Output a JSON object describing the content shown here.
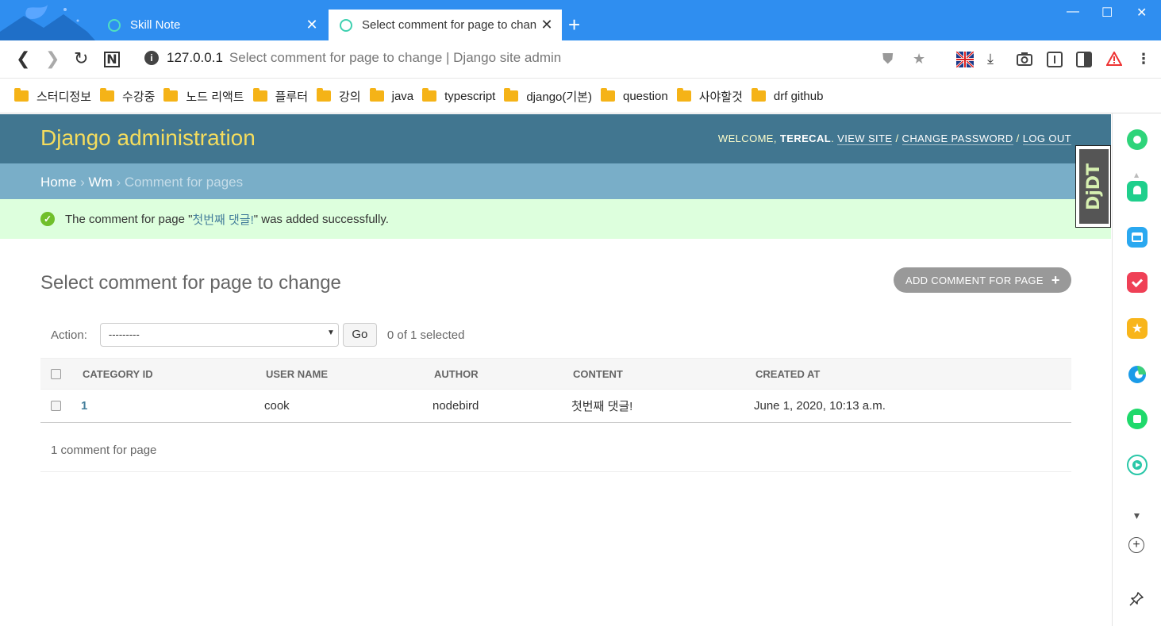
{
  "browser": {
    "tabs": [
      {
        "title": "Skill Note",
        "active": false
      },
      {
        "title": "Select comment for page to change | Django site admin",
        "active": true
      }
    ],
    "new_tab_label": "+",
    "window_controls": {
      "minimize": "—",
      "maximize": "☐",
      "close": "✕"
    },
    "url_host": "127.0.0.1",
    "url_title": "Select comment for page to change | Django site admin",
    "bookmarks": [
      "스터디정보",
      "수강중",
      "노드 리액트",
      "플루터",
      "강의",
      "java",
      "typescript",
      "django(기본)",
      "question",
      "사야할것",
      "drf github"
    ]
  },
  "admin": {
    "brand": "Django administration",
    "user_tools": {
      "welcome": "WELCOME,",
      "username": "TERECAL",
      "view_site": "VIEW SITE",
      "change_password": "CHANGE PASSWORD",
      "log_out": "LOG OUT"
    },
    "breadcrumbs": {
      "home": "Home",
      "app": "Wm",
      "current": "Comment for pages"
    },
    "message": {
      "prefix": "The comment for page \"",
      "link": "첫번째 댓글!",
      "suffix": "\" was added successfully."
    },
    "page_title": "Select comment for page to change",
    "add_button": "ADD COMMENT FOR PAGE",
    "action_label": "Action:",
    "action_value": "---------",
    "go_button": "Go",
    "selection_counter": "0 of 1 selected",
    "columns": [
      "CATEGORY ID",
      "USER NAME",
      "AUTHOR",
      "CONTENT",
      "CREATED AT"
    ],
    "rows": [
      {
        "category_id": "1",
        "user_name": "cook",
        "author": "nodebird",
        "content": "첫번째 댓글!",
        "created_at": "June 1, 2020, 10:13 a.m."
      }
    ],
    "paginator": "1 comment for page"
  },
  "debug_toolbar": {
    "label": "DjDT"
  },
  "colors": {
    "header": "#417690",
    "breadcrumbs": "#79aec8",
    "brand": "#f5dd5d",
    "success_bg": "#ddffdd",
    "chrome_blue": "#2f8ef0"
  }
}
